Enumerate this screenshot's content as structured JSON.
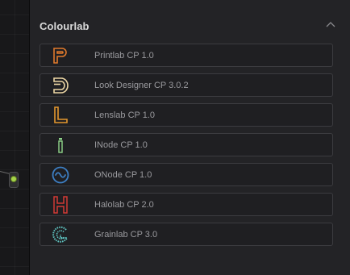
{
  "panel": {
    "section_title": "Colourlab",
    "collapse_icon": "chevron-up-icon"
  },
  "plugins": [
    {
      "label": "Printlab CP 1.0",
      "icon": "printlab-logo-icon",
      "color": "#e07a2c"
    },
    {
      "label": "Look Designer CP 3.0.2",
      "icon": "look-designer-logo-icon",
      "color": "#efd9a6"
    },
    {
      "label": "Lenslab CP 1.0",
      "icon": "lenslab-logo-icon",
      "color": "#e3972e"
    },
    {
      "label": "INode CP 1.0",
      "icon": "inode-logo-icon",
      "color": "#8fd58a"
    },
    {
      "label": "ONode CP 1.0",
      "icon": "onode-logo-icon",
      "color": "#3d7fc4"
    },
    {
      "label": "Halolab CP 2.0",
      "icon": "halolab-logo-icon",
      "color": "#d23a35"
    },
    {
      "label": "Grainlab CP 3.0",
      "icon": "grainlab-logo-icon",
      "color": "#5fc3c1"
    }
  ],
  "node_output": {
    "status_color": "#a6d34a"
  }
}
